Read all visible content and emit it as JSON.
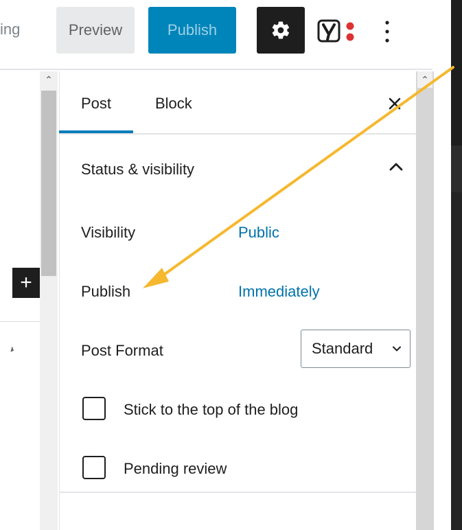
{
  "toolbar": {
    "truncated_left_text": "ing",
    "preview_label": "Preview",
    "publish_label": "Publish",
    "settings_icon": "gear-icon",
    "yoast_icon": "yoast-seo-icon",
    "more_icon": "more-vertical-icon"
  },
  "editor": {
    "inserter_icon": "plus-icon"
  },
  "sidebar": {
    "tabs": [
      {
        "label": "Post",
        "active": true
      },
      {
        "label": "Block",
        "active": false
      }
    ],
    "close_icon": "close-icon",
    "panel": {
      "title": "Status & visibility",
      "expanded": true,
      "rows": {
        "visibility": {
          "label": "Visibility",
          "value": "Public"
        },
        "publish": {
          "label": "Publish",
          "value": "Immediately"
        },
        "post_format": {
          "label": "Post Format",
          "selected": "Standard"
        }
      },
      "checkboxes": [
        {
          "label": "Stick to the top of the blog",
          "checked": false
        },
        {
          "label": "Pending review",
          "checked": false
        }
      ]
    }
  },
  "annotation": {
    "color": "#f5b82e"
  },
  "colors": {
    "accent": "#007cba",
    "publish_button": "#0085ba",
    "link": "#0073aa",
    "dark": "#1e1e1e"
  }
}
